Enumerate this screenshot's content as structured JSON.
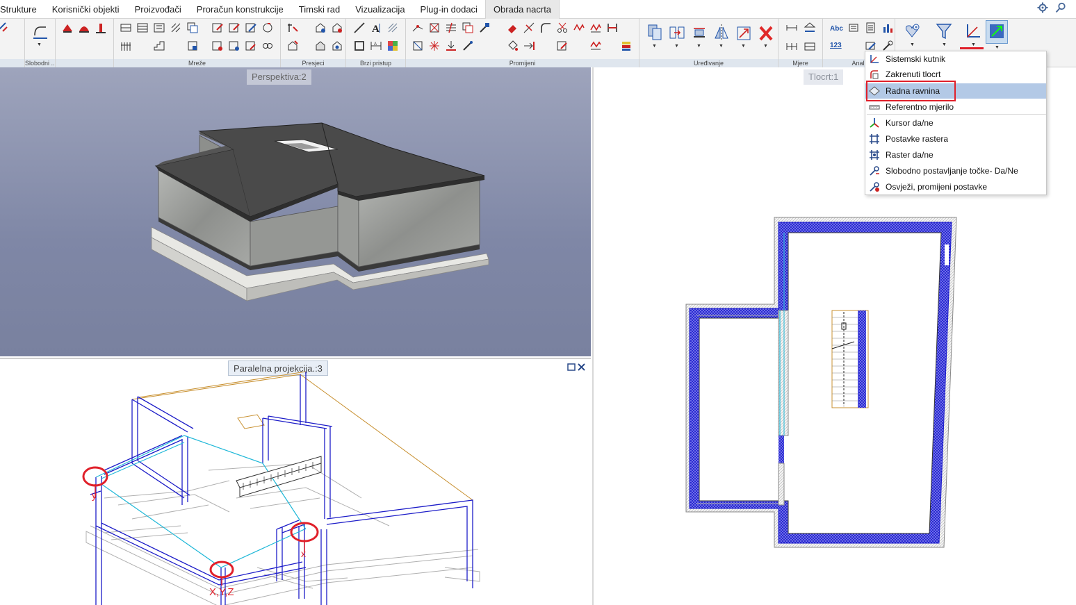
{
  "menu": {
    "tabs": [
      "Strukture",
      "Korisnički objekti",
      "Proizvođači",
      "Proračun konstrukcije",
      "Timski rad",
      "Vizualizacija",
      "Plug-in dodaci",
      "Obrada nacrta"
    ],
    "active_tab": "Obrada nacrta"
  },
  "ribbon": {
    "groups": [
      "Slobodni ...",
      "Mreže",
      "Presjeci",
      "Brzi pristup",
      "Promijeni",
      "Uređivanje",
      "Mjere",
      "Anali"
    ],
    "abc_label": "Abc",
    "num_label": "123"
  },
  "viewports": {
    "perspective": "Perspektiva:2",
    "parallel": "Paralelna projekcija.:3",
    "plan": "Tlocrt:1"
  },
  "annotations": {
    "y_label": "y",
    "x_label": "x",
    "xyz_label": "X,Y,Z"
  },
  "dropdown": {
    "items": [
      {
        "label": "Sistemski kutnik",
        "icon": "axes-icon"
      },
      {
        "label": "Zakrenuti tlocrt",
        "icon": "rotated-plan-icon"
      },
      {
        "label": "Radna ravnina",
        "icon": "work-plane-icon"
      },
      {
        "label": "Referentno mjerilo",
        "icon": "scale-ruler-icon"
      },
      {
        "label": "Kursor da/ne",
        "icon": "cursor-axes-icon"
      },
      {
        "label": "Postavke rastera",
        "icon": "grid-settings-icon"
      },
      {
        "label": "Raster da/ne",
        "icon": "grid-toggle-icon"
      },
      {
        "label": "Slobodno postavljanje točke- Da/Ne",
        "icon": "free-point-icon"
      },
      {
        "label": "Osvježi, promijeni postavke",
        "icon": "refresh-settings-icon"
      }
    ],
    "highlighted": "Radna ravnina"
  },
  "colors": {
    "accent_red": "#e0202a",
    "highlight": "#b3c9e6",
    "wall_blue": "#1c1ccc",
    "ribbon_bg": "#f3f3f3"
  }
}
